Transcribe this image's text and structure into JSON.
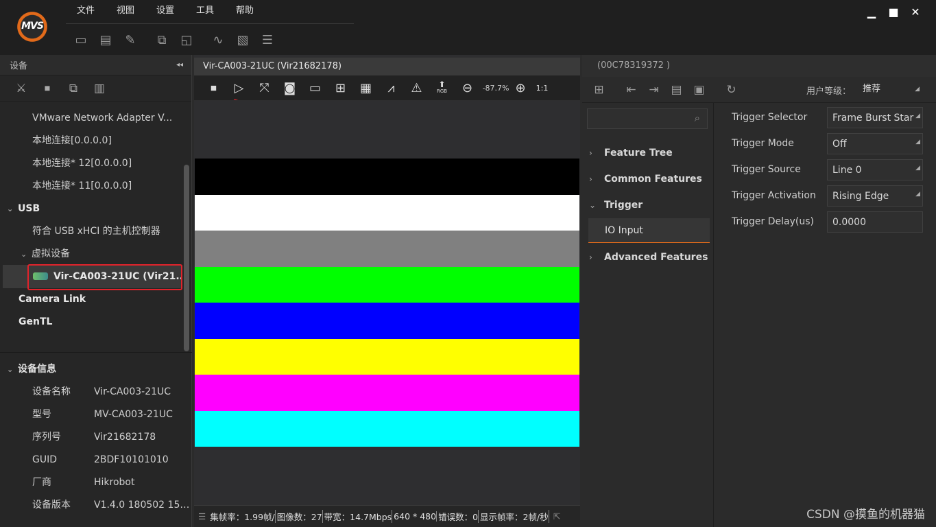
{
  "app": {
    "logo_text": "MVS"
  },
  "menu": {
    "items": [
      "文件",
      "视图",
      "设置",
      "工具",
      "帮助"
    ]
  },
  "window_controls": {
    "minimize": "▁",
    "maximize": "■",
    "close": "✕"
  },
  "toolbar": {
    "icons": [
      "folder-open-icon",
      "save-icon",
      "save-as-icon",
      "display-switch-icon",
      "window-icon",
      "waveform-icon",
      "image-info-icon",
      "list-icon"
    ]
  },
  "left_panel": {
    "title": "设备",
    "collapse_glyph": "◂◂",
    "tree": [
      {
        "label": "VMware Network Adapter V..."
      },
      {
        "label": "本地连接[0.0.0.0]"
      },
      {
        "label": "本地连接* 12[0.0.0.0]"
      },
      {
        "label": "本地连接* 11[0.0.0.0]"
      },
      {
        "label": "USB",
        "caret": "⌄"
      },
      {
        "label": "符合 USB xHCI 的主机控制器"
      },
      {
        "label": "虚拟设备",
        "caret": "⌄"
      },
      {
        "label": "Vir-CA003-21UC (Vir21..."
      },
      {
        "label": "Camera Link"
      },
      {
        "label": "GenTL"
      }
    ],
    "device_info": {
      "title": "设备信息",
      "caret": "⌄",
      "rows": [
        {
          "k": "设备名称",
          "v": "Vir-CA003-21UC"
        },
        {
          "k": "型号",
          "v": "MV-CA003-21UC"
        },
        {
          "k": "序列号",
          "v": "Vir21682178"
        },
        {
          "k": "GUID",
          "v": "2BDF10101010"
        },
        {
          "k": "厂商",
          "v": "Hikrobot"
        },
        {
          "k": "设备版本",
          "v": "V1.4.0 180502 1599..."
        }
      ]
    }
  },
  "center": {
    "tab_title": "Vir-CA003-21UC (Vir21682178)",
    "zoom": "-87.7%",
    "one_to_one": "1:1",
    "rgb_label": "RGB",
    "color_bars": [
      "#000000",
      "#ffffff",
      "#808080",
      "#00ff00",
      "#0000ff",
      "#ffff00",
      "#ff00ff",
      "#00ffff"
    ],
    "status": {
      "collect_fps": "集帧率：1.99帧/",
      "image_count": "图像数：27",
      "bandwidth": "带宽：14.7Mbps",
      "resolution": "640 * 480",
      "errors": "错误数：0",
      "display_fps": "显示帧率：2帧/秒"
    }
  },
  "right_panel": {
    "device_id": "(00C78319372 )",
    "user_level_label": "用户等级：",
    "user_level_value": "推荐",
    "categories": [
      "Feature Tree",
      "Common Features",
      "Trigger",
      "IO Input",
      "Advanced Features"
    ],
    "properties": [
      {
        "name": "Trigger Selector",
        "value": "Frame Burst Star"
      },
      {
        "name": "Trigger Mode",
        "value": "Off"
      },
      {
        "name": "Trigger Source",
        "value": "Line 0"
      },
      {
        "name": "Trigger Activation",
        "value": "Rising Edge"
      },
      {
        "name": "Trigger Delay(us)",
        "value": "0.0000"
      }
    ]
  },
  "watermark": "CSDN @摸鱼的机器猫",
  "colors": {
    "accent": "#e26a1a",
    "highlight_red": "#e1232b"
  }
}
